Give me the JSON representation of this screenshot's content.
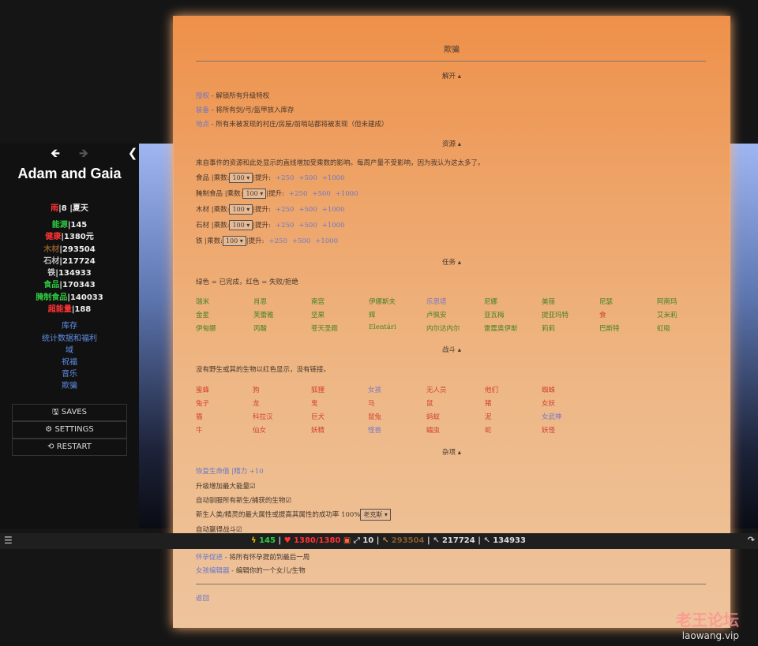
{
  "sidebar": {
    "story_title": "Adam and Gaia",
    "date": {
      "season": "雨",
      "day": "|8 |夏天"
    },
    "stats": [
      {
        "label": "能源",
        "value": "|145",
        "color": "#2ecc40"
      },
      {
        "label": "健康",
        "value": "|1380元",
        "color": "#ff3333"
      },
      {
        "label": "木材",
        "value": "|293504",
        "color": "#8a5a2a"
      },
      {
        "label": "石材",
        "value": "|217724",
        "color": "#bbbbbb"
      },
      {
        "label": "铁",
        "value": "|134933",
        "color": "#cccccc"
      },
      {
        "label": "食品",
        "value": "|170343",
        "color": "#2ecc40"
      },
      {
        "label": "腌制食品",
        "value": "|140033",
        "color": "#2ecc40"
      },
      {
        "label": "超能量",
        "value": "|188",
        "color": "#ff3333"
      }
    ],
    "links": [
      "库存",
      "统计数据和福利",
      "域",
      "祝福",
      "音乐",
      "欺骗"
    ],
    "menu": [
      {
        "icon": "disk",
        "label": "SAVES"
      },
      {
        "icon": "gear",
        "label": "SETTINGS"
      },
      {
        "icon": "restart",
        "label": "RESTART"
      }
    ]
  },
  "statusbar": {
    "energy": "145",
    "health": "1380/1380",
    "level": "10",
    "wood": "293504",
    "stone": "217724",
    "iron": "134933"
  },
  "dialog": {
    "title": "欺骗",
    "unlock": {
      "header": "解开",
      "items": [
        {
          "link": "授权",
          "text": " - 解锁所有升级特权"
        },
        {
          "link": "装备",
          "text": " - 将所有剑/弓/盔甲放入库存"
        },
        {
          "link": "地点",
          "text": " - 所有未被发现的村庄/房屋/前哨站都将被发现（但未建成）"
        }
      ]
    },
    "resources": {
      "header": "资源",
      "intro": "来自事件的资源和此处显示的直线增加受乘数的影响。每周产量不受影响，因为我认为这太多了。",
      "rows": [
        {
          "label": "食品 |乘数:",
          "mult": "100",
          "boost": "|提升:",
          "opts": [
            "+250",
            "+500",
            "+1000"
          ]
        },
        {
          "label": "腌制食品 |乘数:",
          "mult": "100",
          "boost": "|提升:",
          "opts": [
            "+250",
            "+500",
            "+1000"
          ]
        },
        {
          "label": "木材 |乘数:",
          "mult": "100",
          "boost": "|提升:",
          "opts": [
            "+250",
            "+500",
            "+1000"
          ]
        },
        {
          "label": "石材 |乘数:",
          "mult": "100",
          "boost": "|提升:",
          "opts": [
            "+250",
            "+500",
            "+1000"
          ]
        },
        {
          "label": "铁 |乘数:",
          "mult": "100",
          "boost": "|提升:",
          "opts": [
            "+250",
            "+500",
            "+1000"
          ]
        }
      ]
    },
    "tasks": {
      "header": "任务",
      "legend": "绿色 = 已完成，红色 = 失败/拒绝",
      "rows": [
        [
          "瑞米",
          "肖恩",
          "南宫",
          "伊娜斯夫",
          "乐思塔",
          "尼娜",
          "美丽",
          "尼瑟",
          "阿南玛"
        ],
        [
          "金星",
          "芙蕾雅",
          "坚果",
          "辉",
          "卢佩安",
          "亚瓦梅",
          "提亚玛特",
          "食",
          "艾米莉"
        ],
        [
          "伊甸娜",
          "丙酸",
          "苍天圣殿",
          "Elentári",
          "内尔达内尔",
          "雷霆奥伊斯",
          "莉莉",
          "巴斯特",
          "虹吸"
        ]
      ]
    },
    "fight": {
      "header": "战斗",
      "note": "没有野生或其的生物以红色显示，没有链接。",
      "rows": [
        [
          "蜜蜂",
          "狗",
          "狐狸",
          "女孩",
          "无人员",
          "他们",
          "蜘蛛"
        ],
        [
          "兔子",
          "龙",
          "鬼",
          "马",
          "鼠",
          "猪",
          "女妖"
        ],
        [
          "猫",
          "科拉汉",
          "巨犬",
          "鼠兔",
          "蚂蚁",
          "泥",
          "女武神"
        ],
        [
          "牛",
          "仙女",
          "妖精",
          "怪兽",
          "蠕虫",
          "蛇",
          "妖怪"
        ]
      ]
    },
    "misc": {
      "header": "杂项",
      "line1_link": "恢复生命值 |精力 +10",
      "line2": "升级增加最大能量",
      "line3": "自动驯服所有新生/捕获的生物",
      "line4": "新生人类/精灵的最大属性或提高其属性的成功率 100%",
      "line4_select": "老克斯",
      "line5": "自动赢得战斗",
      "line6_link": "怀孕促进",
      "line6_text": " - 将所有怀孕提前到最后一周",
      "line7_link": "女孩编辑器",
      "line7_text": " - 编辑你的一个女儿/生物",
      "back": "返回"
    }
  },
  "watermark": {
    "cn": "老王论坛",
    "url": "laowang.vip"
  }
}
